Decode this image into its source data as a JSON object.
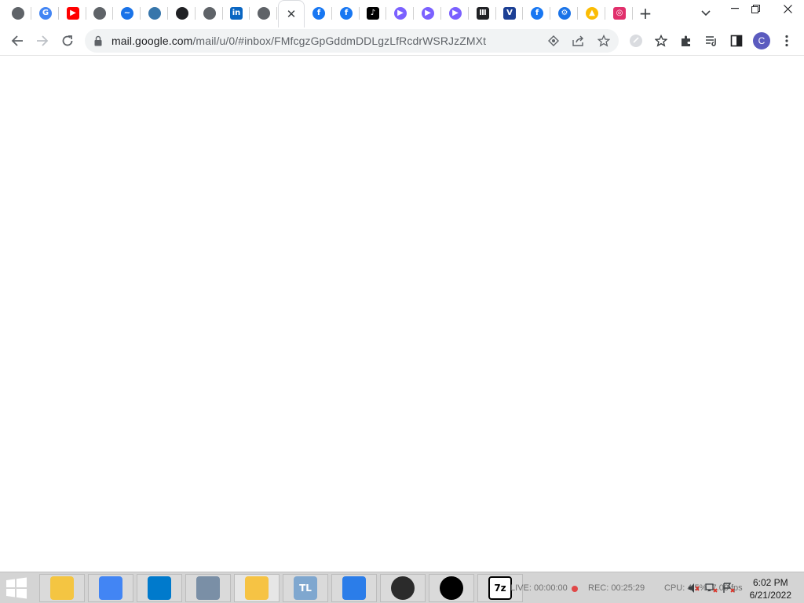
{
  "browser": {
    "tabs": [
      {
        "icon": "globe-icon",
        "color": "#5f6368",
        "glyph": ""
      },
      {
        "icon": "google-icon",
        "color": "#4285f4",
        "glyph": "G"
      },
      {
        "icon": "youtube-icon",
        "color": "#ff0000",
        "glyph": "▶"
      },
      {
        "icon": "globe-icon",
        "color": "#5f6368",
        "glyph": ""
      },
      {
        "icon": "cloud-icon",
        "color": "#1a73e8",
        "glyph": "~"
      },
      {
        "icon": "python-icon",
        "color": "#3776ab",
        "glyph": ""
      },
      {
        "icon": "openai-icon",
        "color": "#202124",
        "glyph": ""
      },
      {
        "icon": "globe-icon",
        "color": "#5f6368",
        "glyph": ""
      },
      {
        "icon": "linkedin-icon",
        "color": "#0a66c2",
        "glyph": "in"
      },
      {
        "icon": "chrome-icon",
        "color": "#5f6368",
        "glyph": ""
      },
      {
        "icon": "close-icon",
        "color": "#3c4043",
        "glyph": "✕"
      },
      {
        "icon": "facebook-icon",
        "color": "#1877f2",
        "glyph": "f"
      },
      {
        "icon": "facebook-icon",
        "color": "#1877f2",
        "glyph": "f"
      },
      {
        "icon": "tiktok-icon",
        "color": "#000000",
        "glyph": "♪"
      },
      {
        "icon": "play-icon",
        "color": "#7b61ff",
        "glyph": "▶"
      },
      {
        "icon": "play-icon",
        "color": "#7b61ff",
        "glyph": "▶"
      },
      {
        "icon": "play-icon",
        "color": "#7b61ff",
        "glyph": "▶"
      },
      {
        "icon": "building-icon",
        "color": "#202124",
        "glyph": "Ⅲ"
      },
      {
        "icon": "v-icon",
        "color": "#1c3f94",
        "glyph": "V"
      },
      {
        "icon": "facebook-icon",
        "color": "#1877f2",
        "glyph": "f"
      },
      {
        "icon": "gear-icon",
        "color": "#1a73e8",
        "glyph": "⚙"
      },
      {
        "icon": "drive-icon",
        "color": "#fbbc04",
        "glyph": "▲"
      },
      {
        "icon": "instagram-icon",
        "color": "#e1306c",
        "glyph": "◎"
      }
    ],
    "active_tab_index": 10,
    "new_tab_label": "+",
    "url": {
      "host": "mail.google.com",
      "path": "/mail/u/0/#inbox/FMfcgzGpGddmDDLgzLfRcdrWSRJzZMXt"
    },
    "profile_initial": "C",
    "accent": "#5b5bbf"
  },
  "taskbar": {
    "apps": [
      {
        "name": "file-explorer-icon",
        "color": "#f4c542",
        "label": ""
      },
      {
        "name": "chrome-icon",
        "color": "#4285f4",
        "label": ""
      },
      {
        "name": "vscode-icon",
        "color": "#007acc",
        "label": ""
      },
      {
        "name": "system-monitor-icon",
        "color": "#7a8fa6",
        "label": ""
      },
      {
        "name": "app-icon",
        "color": "#f6c344",
        "label": ""
      },
      {
        "name": "tl-icon",
        "color": "#7fa7cf",
        "label": "TL"
      },
      {
        "name": "brightness-icon",
        "color": "#2b7de9",
        "label": ""
      },
      {
        "name": "obs-icon",
        "color": "#2b2b2b",
        "label": ""
      },
      {
        "name": "tiktok-icon",
        "color": "#000000",
        "label": ""
      },
      {
        "name": "7zip-icon",
        "color": "#ffffff",
        "label": "7z"
      }
    ],
    "obs_live": "LIVE: 00:00:00",
    "obs_rec": "REC: 00:25:29",
    "obs_cpu": "CPU: 4.5%, 7.00 fps",
    "time": "6:02 PM",
    "date": "6/21/2022"
  }
}
